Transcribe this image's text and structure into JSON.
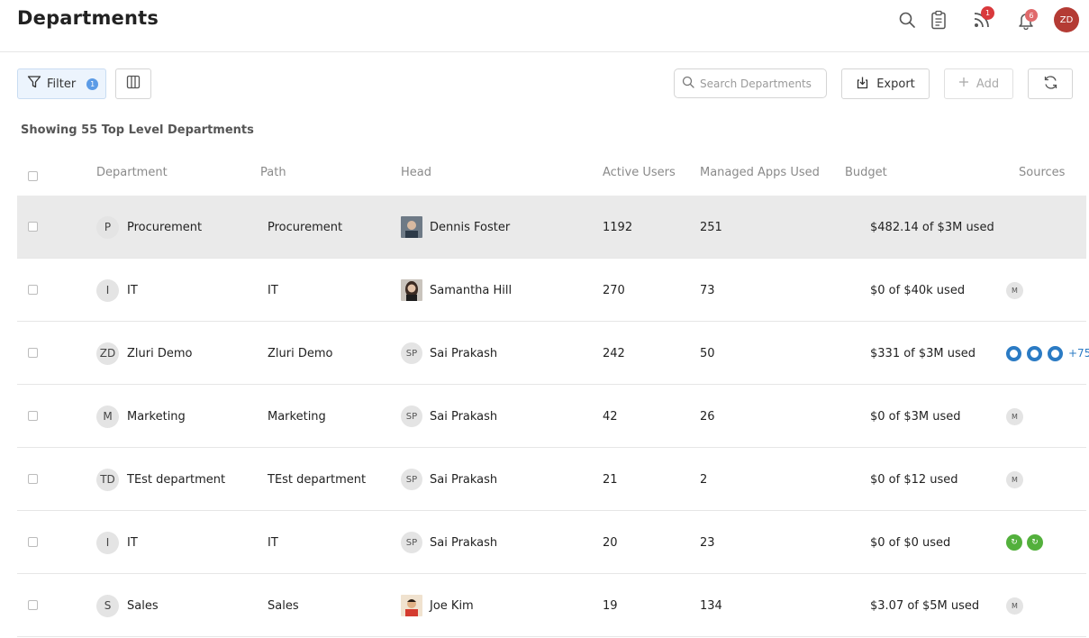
{
  "header": {
    "title": "Departments",
    "icons": [
      "search-icon",
      "clipboard-icon",
      "rss-icon",
      "bell-icon"
    ],
    "rss_badge": "1",
    "bell_badge": "6",
    "user_initials": "ZD",
    "colors": {
      "badge": "#d9393c",
      "avatar": "#b43b34"
    }
  },
  "toolbar": {
    "filter_label": "Filter",
    "filter_count": "1",
    "search_placeholder": "Search Departments",
    "export_label": "Export",
    "add_label": "Add"
  },
  "summary": "Showing 55 Top Level Departments",
  "table": {
    "columns": [
      "Department",
      "Path",
      "Head",
      "Active Users",
      "Managed Apps Used",
      "Budget",
      "Sources"
    ],
    "rows": [
      {
        "initial": "P",
        "department": "Procurement",
        "path": "Procurement",
        "head": "Dennis Foster",
        "head_type": "photo",
        "active_users": "1192",
        "managed_apps": "251",
        "budget": "$482.14 of $3M used",
        "sources": "none"
      },
      {
        "initial": "I",
        "department": "IT",
        "path": "IT",
        "head": "Samantha Hill",
        "head_type": "photo",
        "active_users": "270",
        "managed_apps": "73",
        "budget": "$0 of $40k used",
        "sources": "M"
      },
      {
        "initial": "ZD",
        "department": "Zluri Demo",
        "path": "Zluri Demo",
        "head": "Sai Prakash",
        "head_type": "initials",
        "head_initials": "SP",
        "active_users": "242",
        "managed_apps": "50",
        "budget": "$331 of $3M used",
        "sources": "blue",
        "more": "+75"
      },
      {
        "initial": "M",
        "department": "Marketing",
        "path": "Marketing",
        "head": "Sai Prakash",
        "head_type": "initials",
        "head_initials": "SP",
        "active_users": "42",
        "managed_apps": "26",
        "budget": "$0 of $3M used",
        "sources": "M"
      },
      {
        "initial": "TD",
        "department": "TEst department",
        "path": "TEst department",
        "head": "Sai Prakash",
        "head_type": "initials",
        "head_initials": "SP",
        "active_users": "21",
        "managed_apps": "2",
        "budget": "$0 of $12 used",
        "sources": "M"
      },
      {
        "initial": "I",
        "department": "IT",
        "path": "IT",
        "head": "Sai Prakash",
        "head_type": "initials",
        "head_initials": "SP",
        "active_users": "20",
        "managed_apps": "23",
        "budget": "$0 of $0 used",
        "sources": "green"
      },
      {
        "initial": "S",
        "department": "Sales",
        "path": "Sales",
        "head": "Joe Kim",
        "head_type": "photo",
        "active_users": "19",
        "managed_apps": "134",
        "budget": "$3.07 of $5M used",
        "sources": "M"
      }
    ]
  }
}
